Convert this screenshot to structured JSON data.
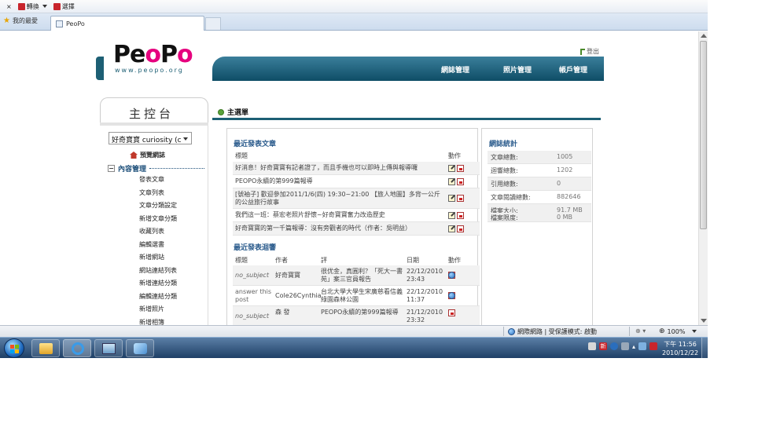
{
  "browser": {
    "close_label": "×",
    "convert_label": "轉換",
    "select_label": "選擇",
    "favorites_label": "我的最愛",
    "tab_title": "PeoPo"
  },
  "header": {
    "logo_p": "Pe",
    "logo_o": "o",
    "logo_p2": "P",
    "logo_o2": "o",
    "logo_sub": "www.peopo.org",
    "logout": "登出",
    "nav": [
      "網誌管理",
      "照片管理",
      "帳戶管理"
    ]
  },
  "sidebar": {
    "title": "主控台",
    "blog_select": "好奇寶寶 curiosity (c",
    "preview": "預覽網誌",
    "collapse_glyph": "−",
    "section": "內容管理",
    "items": [
      "發表文章",
      "文章列表",
      "文章分類設定",
      "新增文章分類",
      "收藏列表",
      "編輯選書",
      "新增網站",
      "網站連結列表",
      "新增連結分類",
      "編輯連結分類",
      "新增照片",
      "新增相簿"
    ]
  },
  "main": {
    "title": "主選單",
    "recent_posts": {
      "title": "最近發表文章",
      "col_title": "標題",
      "col_action": "動作",
      "rows": [
        "好消息！好奇寶寶有記者證了，而且手機也可以即時上傳與報導囉",
        "PEOPO永續的第999篇報導",
        "[號袖子] 歡迎參加2011/1/6(四) 19:30~21:00 【旅人地圖】多背一公斤的公益旅行故事",
        "我們這一班：蔡宏老照片舒懷~好奇寶寶奮力改造歷史",
        "好奇寶寶的第一千篇報導：沒有旁觀者的時代（作者：吳明益）"
      ]
    },
    "recent_comments": {
      "title": "最近發表迴響",
      "col_title": "標題",
      "col_author": "作者",
      "col_comment": "評",
      "col_date": "日期",
      "col_action": "動作",
      "rows": [
        {
          "subject": "no_subject",
          "author": "好奇寶寶",
          "comment": "很优金，真圓利？「死大一書苑」案三官員報告",
          "date": "22/12/2010 23:43"
        },
        {
          "subject": "answer this post",
          "author": "Cole26Cynthia",
          "comment": "台北大學大學生宋廣慈看信義綠園森林公園",
          "date": "22/12/2010 11:37"
        },
        {
          "subject": "no_subject",
          "author": "森 發",
          "comment": "PEOPO永續的第999篇報導",
          "date": "21/12/2010 23:32"
        }
      ]
    },
    "stats": {
      "title": "網誌統計",
      "rows": [
        {
          "key": "文章總數:",
          "value": "1005"
        },
        {
          "key": "迴響總數:",
          "value": "1202"
        },
        {
          "key": "引用總數:",
          "value": "0"
        },
        {
          "key": "文章閱讀總數:",
          "value": "882646"
        },
        {
          "key": "檔案大小:",
          "value": "91.7 MB"
        },
        {
          "key": "檔案限度:",
          "value": "0 MB"
        }
      ]
    }
  },
  "statusbar": {
    "zone": "網際網路 | 受保護模式: 啟動",
    "zoom": "100%"
  },
  "taskbar": {
    "ime": "新",
    "clock_time": "下午 11:56",
    "clock_date": "2010/12/22"
  },
  "colors": {
    "brand_teal": "#1d5f74",
    "brand_pink": "#e6007e",
    "link_blue": "#2a5b8c"
  }
}
